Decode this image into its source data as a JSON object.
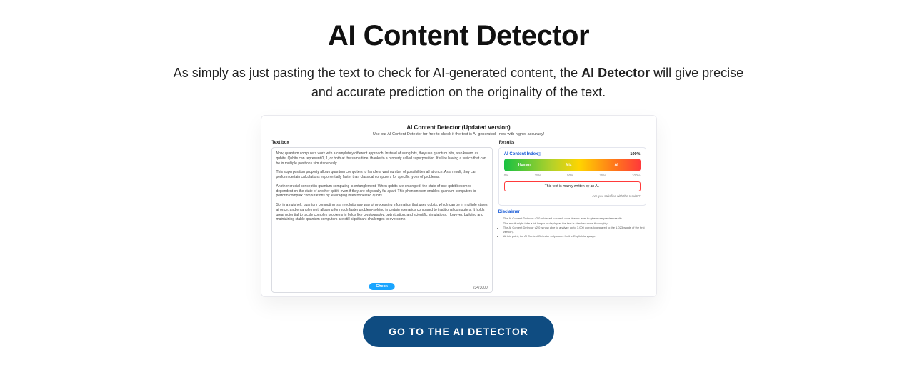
{
  "headline": "AI Content Detector",
  "subhead_pre": "As simply as just pasting the text to check for AI-generated content, the ",
  "subhead_strong": "AI Detector",
  "subhead_post": " will give precise and accurate prediction on the originality of the text.",
  "mock": {
    "title": "AI Content Detector (Updated version)",
    "subtitle": "Use our AI Content Detector for free to check if the text is AI-generated - now with higher accuracy!",
    "textbox_label": "Text box",
    "paragraphs": [
      "Now, quantum computers work with a completely different approach. Instead of using bits, they use quantum bits, also known as qubits. Qubits can represent 0, 1, or both at the same time, thanks to a property called superposition. It's like having a switch that can be in multiple positions simultaneously.",
      "This superposition property allows quantum computers to handle a vast number of possibilities all at once. As a result, they can perform certain calculations exponentially faster than classical computers for specific types of problems.",
      "Another crucial concept in quantum computing is entanglement. When qubits are entangled, the state of one qubit becomes dependent on the state of another qubit, even if they are physically far apart. This phenomenon enables quantum computers to perform complex computations by leveraging interconnected qubits.",
      "So, in a nutshell, quantum computing is a revolutionary way of processing information that uses qubits, which can be in multiple states at once, and entanglement, allowing for much faster problem-solving in certain scenarios compared to traditional computers. It holds great potential to tackle complex problems in fields like cryptography, optimization, and scientific simulations. However, building and maintaining stable quantum computers are still significant challenges to overcome."
    ],
    "counter": "234/3000",
    "check_label": "Check",
    "results_label": "Results",
    "index_title": "AI Content Index",
    "index_pct": "100%",
    "meter_labels": {
      "human": "Human",
      "mix": "Mix",
      "ai": "AI"
    },
    "ticks": [
      "0%",
      "25%",
      "50%",
      "75%",
      "100%"
    ],
    "verdict": "This text is mainly written by an AI.",
    "satisfied": "Are you satisfied with the results?",
    "disclaimer_title": "Disclaimer",
    "disclaimer_items": [
      "The AI Content Detector v2.0 is biased to check on a deeper level to give more precise results.",
      "The result might take a bit longer to display as the text is checked more thoroughly.",
      "The AI Content Detector v2.0 is now able to analyze up to 3,000 words (compared to the 1,023 words of the first version).",
      "At this point, the AI Content Detector only works for the English language."
    ]
  },
  "cta_label": "GO TO THE AI DETECTOR"
}
